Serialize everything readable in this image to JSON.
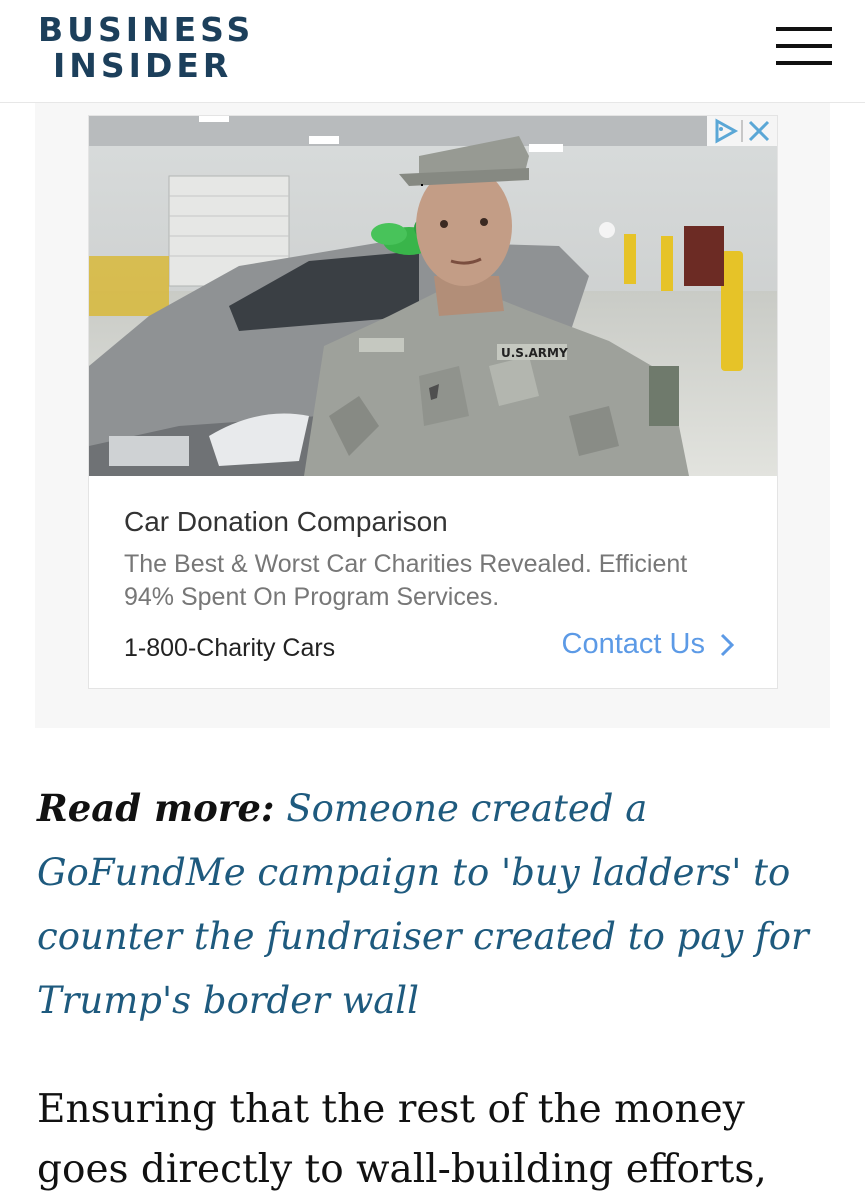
{
  "header": {
    "logo_line1": "BUSINESS",
    "logo_line2": "INSIDER",
    "brand_color": "#1c3f5b",
    "menu_icon": "hamburger-menu-icon"
  },
  "ad": {
    "image_alt": "U.S. Army soldier standing next to a donated car with a green bow",
    "badge_icons": [
      "adchoices-icon",
      "close-icon"
    ],
    "title": "Car Donation Comparison",
    "description": "The Best & Worst Car Charities Revealed. Efficient 94% Spent On Program Services.",
    "advertiser": "1-800-Charity Cars",
    "cta_label": "Contact Us",
    "cta_icon": "chevron-right-icon",
    "cta_color": "#5c9ae6"
  },
  "article": {
    "read_more_label": "Read more:",
    "read_more_link": "Someone created a GoFundMe campaign to 'buy ladders' to counter the fundraiser created to pay for Trump's border wall",
    "body_text": "Ensuring that the rest of the money goes directly to wall-building efforts,",
    "link_color": "#1e5a7e"
  }
}
